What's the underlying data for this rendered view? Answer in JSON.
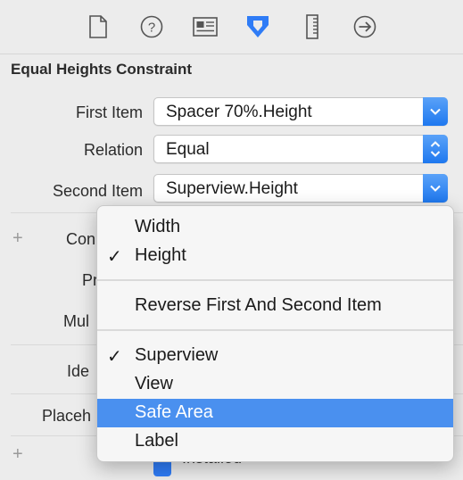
{
  "toolbar": {
    "icons": [
      "file-inspector-icon",
      "quick-help-icon",
      "identity-inspector-icon",
      "attributes-inspector-icon",
      "size-inspector-icon",
      "connections-inspector-icon"
    ],
    "accent_color": "#2f7cf6"
  },
  "section_title": "Equal Heights Constraint",
  "fields": {
    "first_item": {
      "label": "First Item",
      "value": "Spacer 70%.Height"
    },
    "relation": {
      "label": "Relation",
      "value": "Equal"
    },
    "second_item": {
      "label": "Second Item",
      "value": "Superview.Height"
    }
  },
  "obscured": {
    "constant": "Con",
    "priority": "Pr",
    "multiplier": "Mul",
    "identifier": "Ide",
    "placeholder": "Placeh",
    "installed": "Installed"
  },
  "menu": {
    "items": [
      {
        "label": "Width",
        "checked": false,
        "highlighted": false
      },
      {
        "label": "Height",
        "checked": true,
        "highlighted": false
      },
      {
        "label": "Reverse First And Second Item",
        "checked": false,
        "highlighted": false
      },
      {
        "label": "Superview",
        "checked": true,
        "highlighted": false
      },
      {
        "label": "View",
        "checked": false,
        "highlighted": false
      },
      {
        "label": "Safe Area",
        "checked": false,
        "highlighted": true
      },
      {
        "label": "Label",
        "checked": false,
        "highlighted": false
      }
    ],
    "check_glyph": "✓",
    "highlight_color": "#4a90ef"
  }
}
